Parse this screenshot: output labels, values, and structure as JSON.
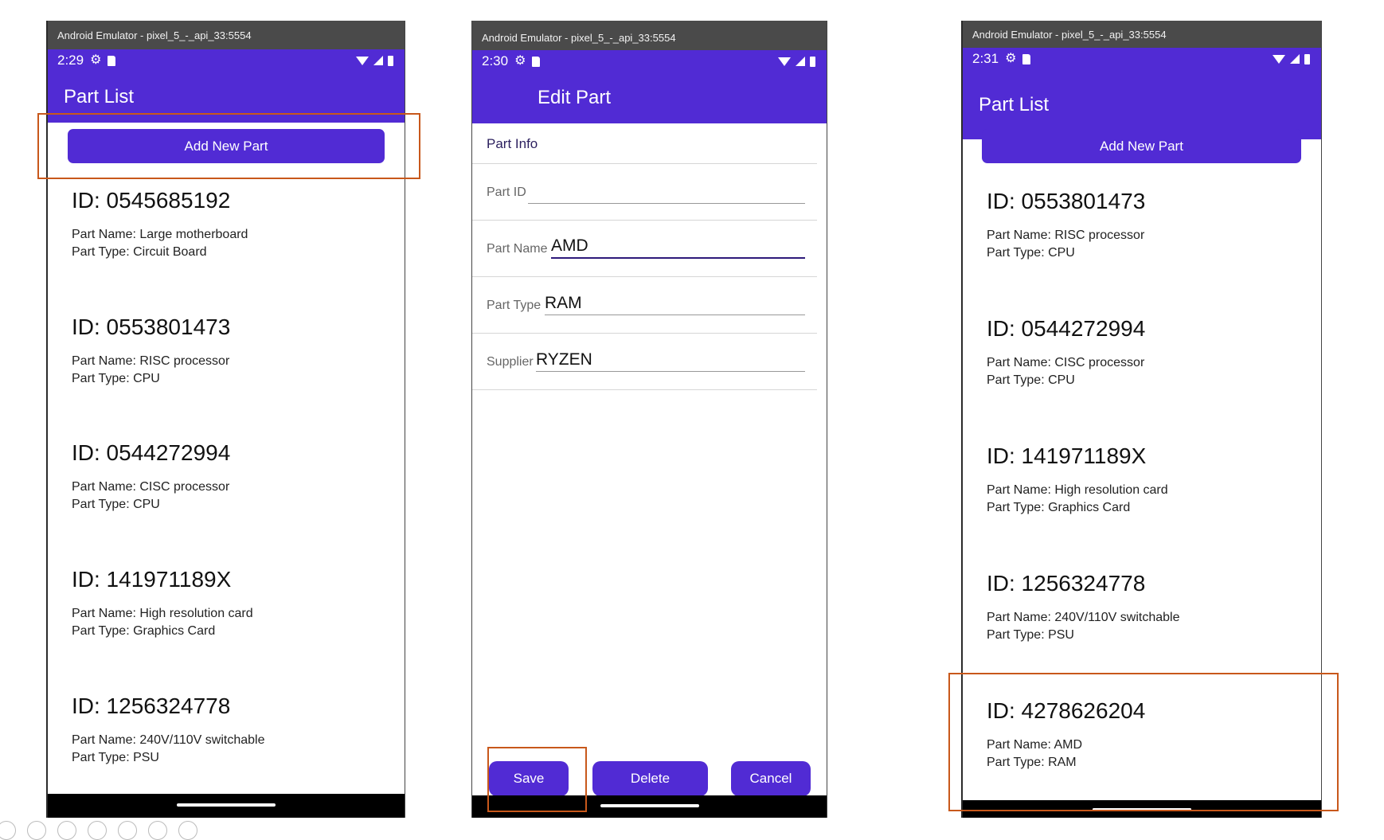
{
  "colors": {
    "accent": "#512bd4",
    "highlight": "#c8581b",
    "emulator_bar": "#4a4a4a"
  },
  "screens": [
    {
      "emulator_title": "Android Emulator - pixel_5_-_api_33:5554",
      "time": "2:29",
      "app_title": "Part List",
      "add_button": "Add New Part",
      "parts": [
        {
          "id": "ID: 0545685192",
          "name": "Part Name: Large motherboard",
          "type": "Part Type: Circuit Board"
        },
        {
          "id": "ID: 0553801473",
          "name": "Part Name: RISC processor",
          "type": "Part Type: CPU"
        },
        {
          "id": "ID: 0544272994",
          "name": "Part Name: CISC processor",
          "type": "Part Type: CPU"
        },
        {
          "id": "ID: 141971189X",
          "name": "Part Name: High resolution card",
          "type": "Part Type: Graphics Card"
        },
        {
          "id": "ID: 1256324778",
          "name": "Part Name: 240V/110V switchable",
          "type": "Part Type: PSU"
        }
      ]
    },
    {
      "emulator_title": "Android Emulator - pixel_5_-_api_33:5554",
      "time": "2:30",
      "app_title": "Edit Part",
      "section_header": "Part Info",
      "fields": [
        {
          "label": "Part ID",
          "value": ""
        },
        {
          "label": "Part Name",
          "value": "AMD"
        },
        {
          "label": "Part Type",
          "value": "RAM"
        },
        {
          "label": "Supplier",
          "value": "RYZEN"
        }
      ],
      "buttons": {
        "save": "Save",
        "delete": "Delete",
        "cancel": "Cancel"
      }
    },
    {
      "emulator_title": "Android Emulator - pixel_5_-_api_33:5554",
      "time": "2:31",
      "app_title": "Part List",
      "add_button": "Add New Part",
      "parts": [
        {
          "id": "ID: 0553801473",
          "name": "Part Name: RISC processor",
          "type": "Part Type: CPU"
        },
        {
          "id": "ID: 0544272994",
          "name": "Part Name: CISC processor",
          "type": "Part Type: CPU"
        },
        {
          "id": "ID: 141971189X",
          "name": "Part Name: High resolution card",
          "type": "Part Type: Graphics Card"
        },
        {
          "id": "ID: 1256324778",
          "name": "Part Name: 240V/110V switchable",
          "type": "Part Type: PSU"
        },
        {
          "id": "ID: 4278626204",
          "name": "Part Name: AMD",
          "type": "Part Type: RAM"
        }
      ]
    }
  ]
}
